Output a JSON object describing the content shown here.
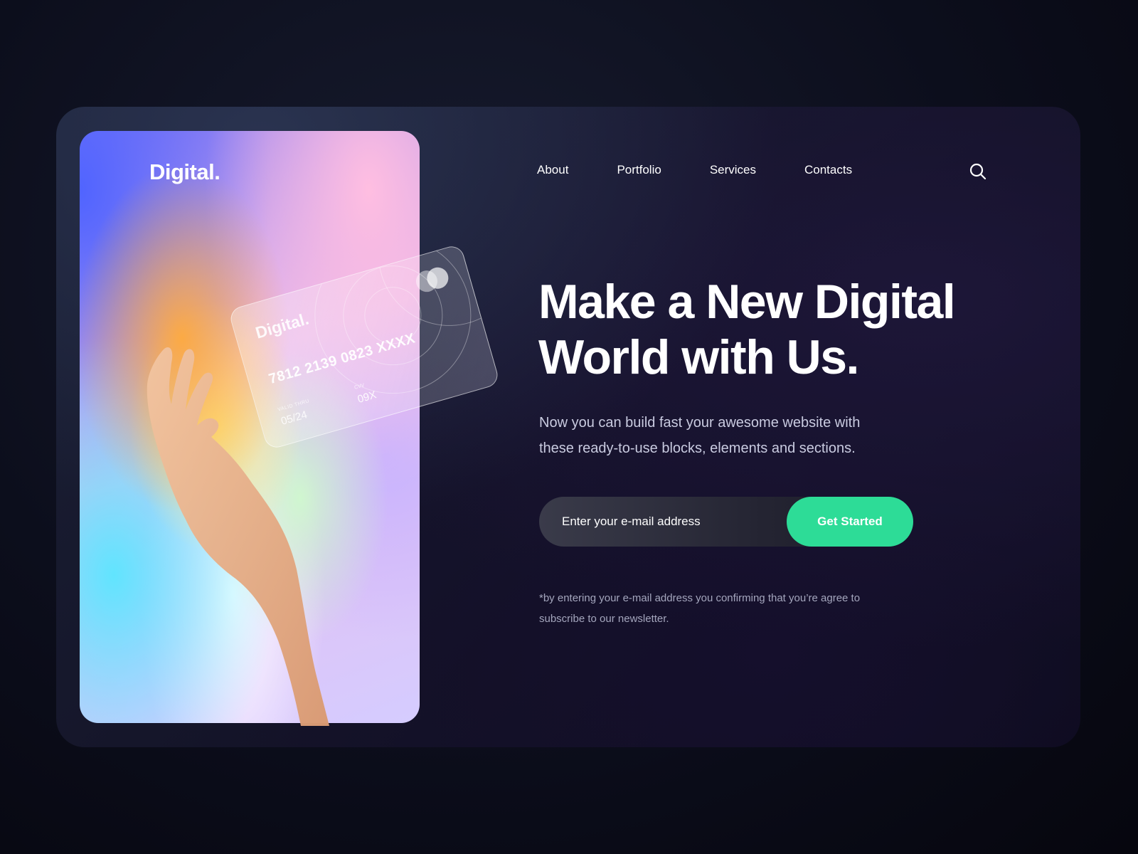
{
  "brand": {
    "logo": "Digital."
  },
  "card": {
    "logo": "Digital.",
    "number": "7812 2139 0823 XXXX",
    "valid_label": "VALID THRU",
    "valid": "05/24",
    "cvv_label": "CVV",
    "cvv": "09X"
  },
  "nav": {
    "items": [
      {
        "label": "About"
      },
      {
        "label": "Portfolio"
      },
      {
        "label": "Services"
      },
      {
        "label": "Contacts"
      }
    ],
    "search_icon": "search-icon"
  },
  "hero": {
    "headline_line1": "Make a New Digital",
    "headline_line2": "World with Us.",
    "subtext": "Now you can build fast your awesome website with these ready-to-use blocks, elements and sections."
  },
  "signup": {
    "placeholder": "Enter your e-mail address",
    "button_label": "Get Started",
    "disclaimer": "*by entering your e-mail address you confirming that you’re agree to subscribe to our newsletter."
  },
  "colors": {
    "accent": "#2ddc97",
    "background": "#0c0e1c",
    "text": "#ffffff",
    "muted": "#a4a6bd"
  }
}
